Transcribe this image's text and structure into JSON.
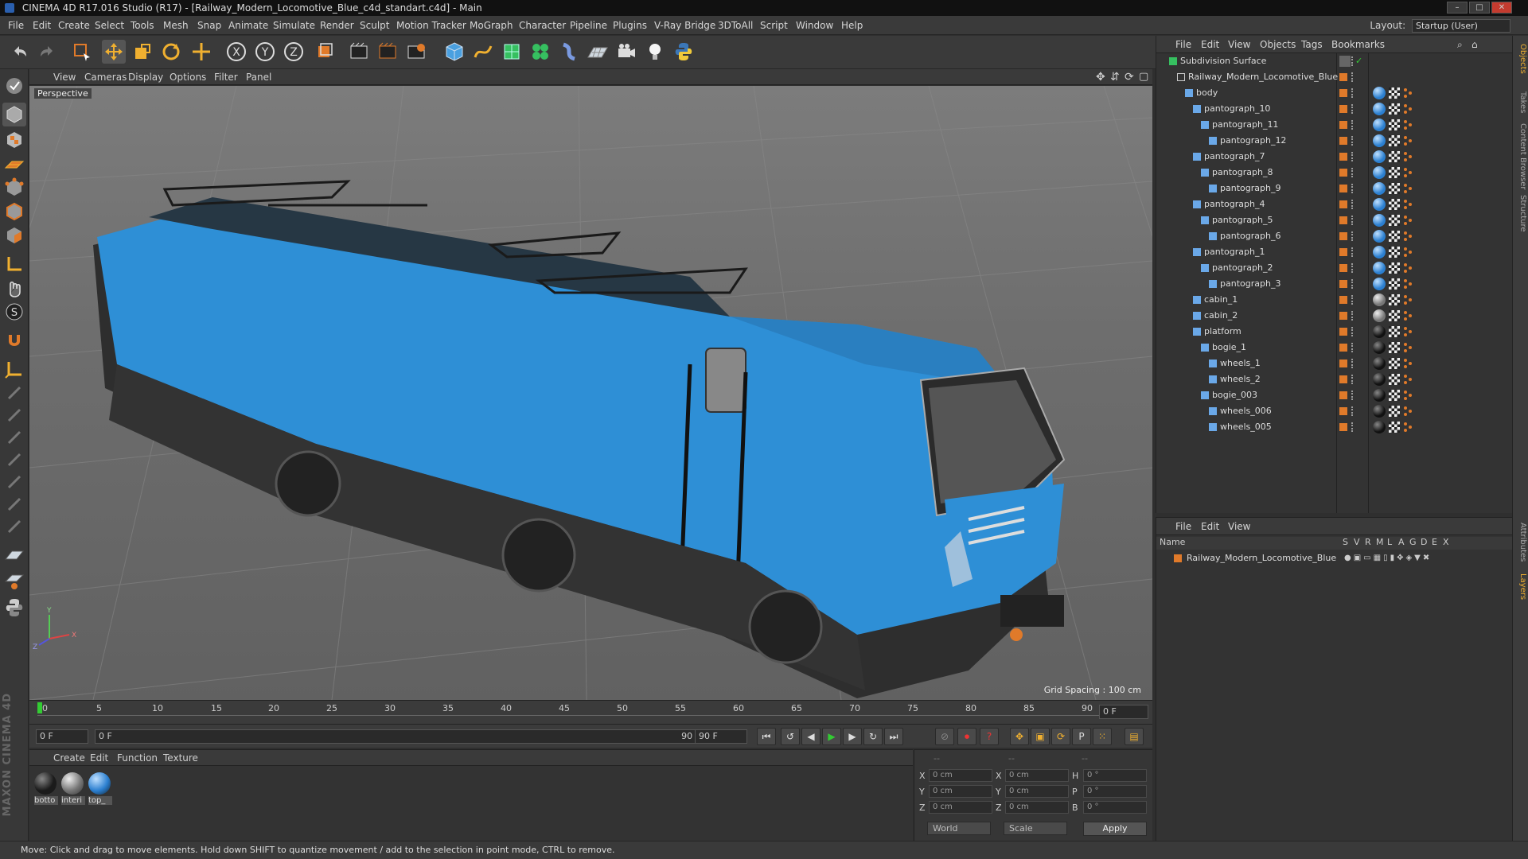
{
  "window": {
    "title": "CINEMA 4D R17.016 Studio (R17) - [Railway_Modern_Locomotive_Blue_c4d_standart.c4d] - Main"
  },
  "menubar": {
    "items": [
      "File",
      "Edit",
      "Create",
      "Select",
      "Tools",
      "Mesh",
      "Snap",
      "Animate",
      "Simulate",
      "Render",
      "Sculpt",
      "Motion Tracker",
      "MoGraph",
      "Character",
      "Pipeline",
      "Plugins",
      "V-Ray Bridge",
      "3DToAll",
      "Script",
      "Window",
      "Help"
    ],
    "layout_label": "Layout:",
    "layout_value": "Startup (User)"
  },
  "viewport": {
    "menu": [
      "View",
      "Cameras",
      "Display",
      "Options",
      "Filter",
      "Panel"
    ],
    "label": "Perspective",
    "grid_spacing": "Grid Spacing : 100 cm"
  },
  "timeline": {
    "ticks": [
      "0",
      "5",
      "10",
      "15",
      "20",
      "25",
      "30",
      "35",
      "40",
      "45",
      "50",
      "55",
      "60",
      "65",
      "70",
      "75",
      "80",
      "85",
      "90"
    ],
    "end_field": "0 F",
    "current_frame": "0 F",
    "range_start": "0 F",
    "range_end": "90 F",
    "max_frame": "90 F"
  },
  "materials": {
    "menu": [
      "Create",
      "Edit",
      "Function",
      "Texture"
    ],
    "items": [
      {
        "name": "botto",
        "color": "#1b1b1b"
      },
      {
        "name": "interi",
        "color": "#777777"
      },
      {
        "name": "top_",
        "color": "#2b7fd0"
      }
    ]
  },
  "coordinates": {
    "headers": [
      "--",
      "--",
      "--"
    ],
    "rows": [
      {
        "a": "X",
        "a_val": "0 cm",
        "b": "X",
        "b_val": "0 cm",
        "c": "H",
        "c_val": "0 °"
      },
      {
        "a": "Y",
        "a_val": "0 cm",
        "b": "Y",
        "b_val": "0 cm",
        "c": "P",
        "c_val": "0 °"
      },
      {
        "a": "Z",
        "a_val": "0 cm",
        "b": "Z",
        "b_val": "0 cm",
        "c": "B",
        "c_val": "0 °"
      }
    ],
    "space": "World",
    "mode": "Scale",
    "apply": "Apply"
  },
  "objects_panel": {
    "menu": [
      "File",
      "Edit",
      "View",
      "Objects",
      "Tags",
      "Bookmarks"
    ],
    "tree": [
      {
        "name": "Subdivision Surface",
        "depth": 0
      },
      {
        "name": "Railway_Modern_Locomotive_Blue",
        "depth": 1
      },
      {
        "name": "body",
        "depth": 2
      },
      {
        "name": "pantograph_10",
        "depth": 3
      },
      {
        "name": "pantograph_11",
        "depth": 4
      },
      {
        "name": "pantograph_12",
        "depth": 5
      },
      {
        "name": "pantograph_7",
        "depth": 3
      },
      {
        "name": "pantograph_8",
        "depth": 4
      },
      {
        "name": "pantograph_9",
        "depth": 5
      },
      {
        "name": "pantograph_4",
        "depth": 3
      },
      {
        "name": "pantograph_5",
        "depth": 4
      },
      {
        "name": "pantograph_6",
        "depth": 5
      },
      {
        "name": "pantograph_1",
        "depth": 3
      },
      {
        "name": "pantograph_2",
        "depth": 4
      },
      {
        "name": "pantograph_3",
        "depth": 5
      },
      {
        "name": "cabin_1",
        "depth": 3
      },
      {
        "name": "cabin_2",
        "depth": 3
      },
      {
        "name": "platform",
        "depth": 3
      },
      {
        "name": "bogie_1",
        "depth": 4
      },
      {
        "name": "wheels_1",
        "depth": 5
      },
      {
        "name": "wheels_2",
        "depth": 5
      },
      {
        "name": "bogie_003",
        "depth": 4
      },
      {
        "name": "wheels_006",
        "depth": 5
      },
      {
        "name": "wheels_005",
        "depth": 5
      }
    ]
  },
  "layers_panel": {
    "menu": [
      "File",
      "Edit",
      "View"
    ],
    "columns": [
      "Name",
      "S",
      "V",
      "R",
      "M",
      "L",
      "A",
      "G",
      "D",
      "E",
      "X"
    ],
    "layer_name": "Railway_Modern_Locomotive_Blue"
  },
  "right_tabs": [
    "Objects",
    "Takes",
    "Content Browser",
    "Structure",
    "Attributes",
    "Layers"
  ],
  "status": "Move: Click and drag to move elements. Hold down SHIFT to quantize movement / add to the selection in point mode, CTRL to remove.",
  "brand": "MAXON CINEMA 4D",
  "axis_labels": {
    "x": "X",
    "y": "Y",
    "z": "Z"
  },
  "colors": {
    "accent": "#e07a2a",
    "locomotive_blue": "#2e8fd6",
    "ui_bg": "#333333"
  }
}
